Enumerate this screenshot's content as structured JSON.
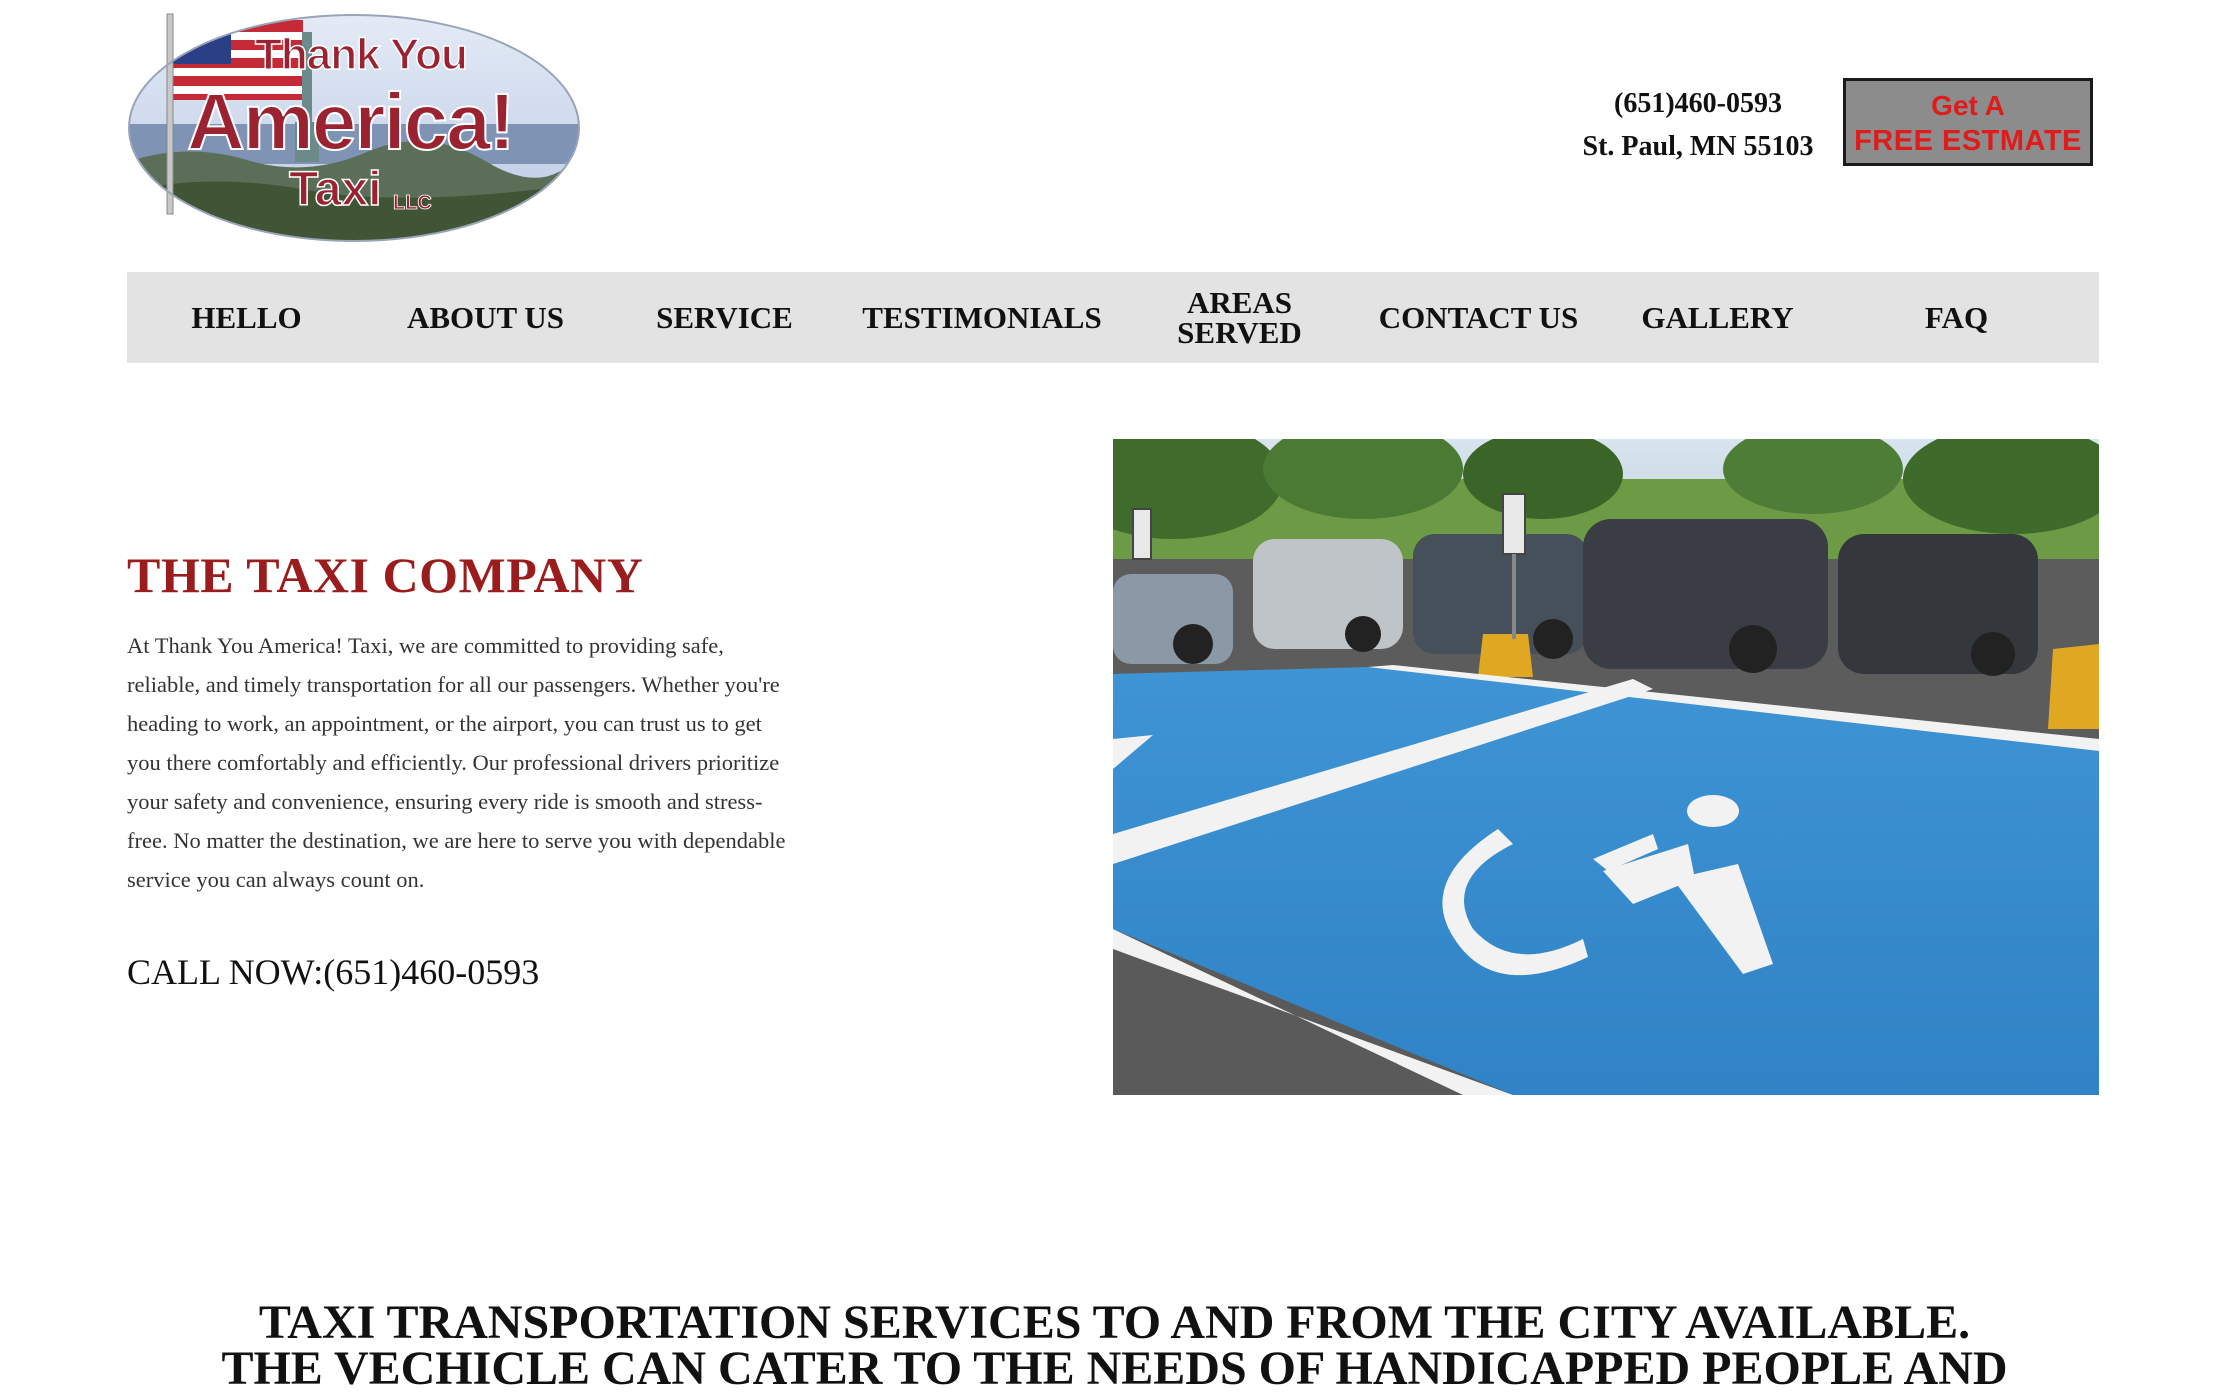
{
  "logo": {
    "line1": "Thank You",
    "line2": "America!",
    "line3": "Taxi",
    "line3_suffix": "LLC",
    "colors": {
      "text": "#9b2331",
      "outline": "#ffffff",
      "sky": "#c9d6ec"
    }
  },
  "header": {
    "phone": "(651)460-0593",
    "address": "St. Paul, MN 55103",
    "estimate_line1": "Get A",
    "estimate_line2": "FREE ESTMATE"
  },
  "nav": {
    "items": [
      {
        "label": "HELLO"
      },
      {
        "label": "ABOUT US"
      },
      {
        "label": "SERVICE"
      },
      {
        "label": "TESTIMONIALS"
      },
      {
        "label": "AREAS\nSERVED"
      },
      {
        "label": "CONTACT US"
      },
      {
        "label": "GALLERY"
      },
      {
        "label": "FAQ"
      }
    ]
  },
  "intro": {
    "title": "THE TAXI COMPANY",
    "body": "At Thank You America! Taxi, we are committed to providing safe, reliable, and timely transportation for all our passengers. Whether you're heading to work, an appointment, or the airport, you can trust us to get you there comfortably and efficiently. Our professional drivers prioritize your safety and convenience, ensuring every ride is smooth and stress-free. No matter the destination, we are here to serve you with dependable service you can always count on.",
    "call_now": "CALL NOW:(651)460-0593"
  },
  "hero_image": {
    "icon": "accessible-parking-icon"
  },
  "banner": {
    "line1": "TAXI TRANSPORTATION SERVICES TO AND FROM THE CITY AVAILABLE.",
    "line2": "THE VECHICLE CAN CATER TO THE NEEDS OF HANDICAPPED PEOPLE AND"
  },
  "colors": {
    "title_red": "#9a1c1c",
    "button_red": "#e01b1b",
    "button_gray": "#8c8c8c",
    "nav_bg": "#e3e3e3",
    "parking_blue": "#3b8fd1"
  }
}
